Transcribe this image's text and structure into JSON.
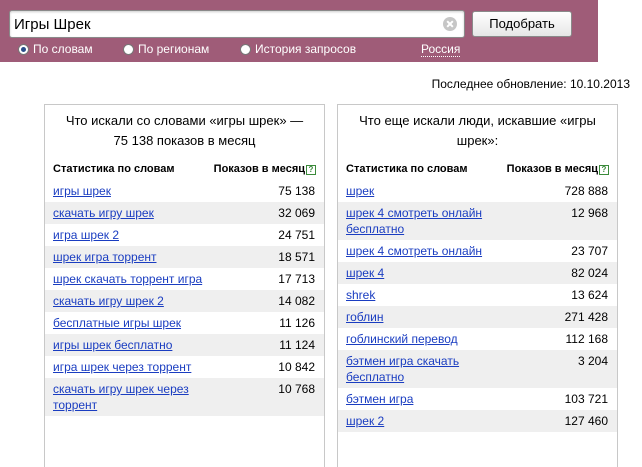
{
  "search": {
    "value": "Игры Шрек",
    "submit_label": "Подобрать"
  },
  "modes": [
    {
      "label": "По словам",
      "selected": true
    },
    {
      "label": "По регионам",
      "selected": false
    },
    {
      "label": "История запросов",
      "selected": false
    }
  ],
  "region": "Россия",
  "last_update": "Последнее обновление: 10.10.2013",
  "left_panel": {
    "title": "Что искали со словами «игры шрек» — 75 138 показов в месяц",
    "col_a": "Статистика по словам",
    "col_b": "Показов в месяц",
    "rows": [
      {
        "phrase": "игры шрек",
        "count": "75 138"
      },
      {
        "phrase": "скачать игру шрек",
        "count": "32 069"
      },
      {
        "phrase": "игра шрек 2",
        "count": "24 751"
      },
      {
        "phrase": "шрек игра торрент",
        "count": "18 571"
      },
      {
        "phrase": "шрек скачать торрент игра",
        "count": "17 713"
      },
      {
        "phrase": "скачать игру шрек 2",
        "count": "14 082"
      },
      {
        "phrase": "бесплатные игры шрек",
        "count": "11 126"
      },
      {
        "phrase": "игры шрек бесплатно",
        "count": "11 124"
      },
      {
        "phrase": "игра шрек через торрент",
        "count": "10 842"
      },
      {
        "phrase": "скачать игру шрек через торрент",
        "count": "10 768"
      }
    ]
  },
  "right_panel": {
    "title": "Что еще искали люди, искавшие «игры шрек»:",
    "col_a": "Статистика по словам",
    "col_b": "Показов в месяц",
    "rows": [
      {
        "phrase": "шрек",
        "count": "728 888"
      },
      {
        "phrase": "шрек 4 смотреть онлайн бесплатно",
        "count": "12 968"
      },
      {
        "phrase": "шрек 4 смотреть онлайн",
        "count": "23 707"
      },
      {
        "phrase": "шрек 4",
        "count": "82 024"
      },
      {
        "phrase": "shrek",
        "count": "13 624"
      },
      {
        "phrase": "гоблин",
        "count": "271 428"
      },
      {
        "phrase": "гоблинский перевод",
        "count": "112 168"
      },
      {
        "phrase": "бэтмен игра скачать бесплатно",
        "count": "3 204"
      },
      {
        "phrase": "бэтмен игра",
        "count": "103 721"
      },
      {
        "phrase": "шрек 2",
        "count": "127 460"
      }
    ]
  },
  "colors": {
    "banner": "#9f5c78",
    "link": "#1a3dc1",
    "row_alt": "#efefef"
  }
}
